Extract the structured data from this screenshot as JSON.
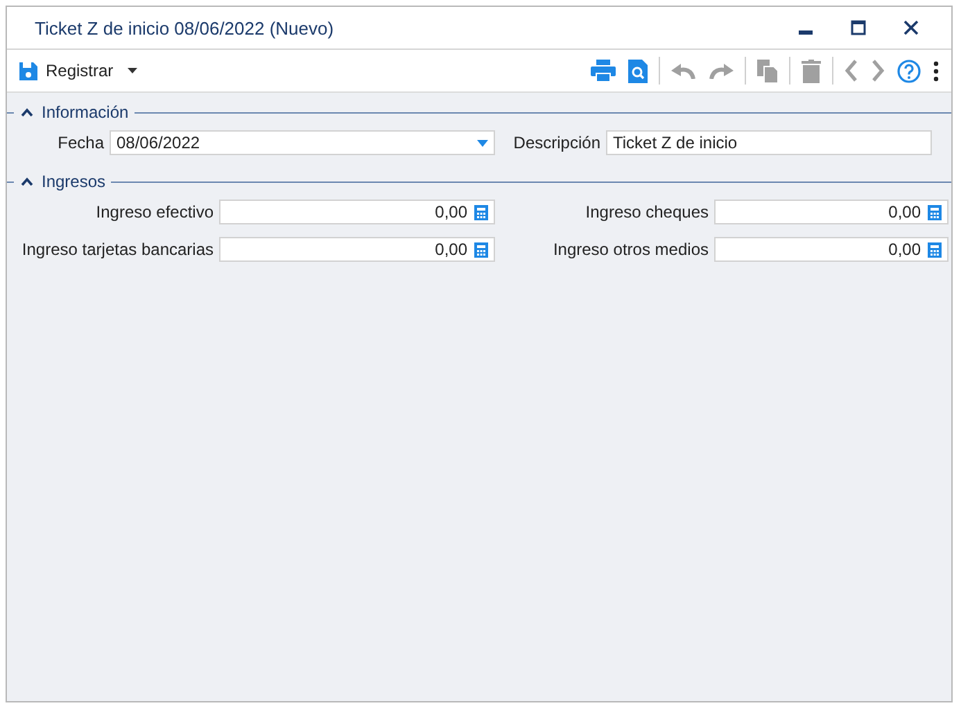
{
  "window": {
    "title": "Ticket Z de inicio 08/06/2022 (Nuevo)"
  },
  "toolbar": {
    "register_label": "Registrar",
    "tools": [
      {
        "kind": "print",
        "disabled": false
      },
      {
        "kind": "preview",
        "disabled": false
      },
      {
        "kind": "sep"
      },
      {
        "kind": "undo",
        "disabled": true
      },
      {
        "kind": "redo",
        "disabled": true
      },
      {
        "kind": "sep"
      },
      {
        "kind": "copy",
        "disabled": true
      },
      {
        "kind": "sep"
      },
      {
        "kind": "delete",
        "disabled": true
      },
      {
        "kind": "sep"
      },
      {
        "kind": "prev",
        "disabled": true
      },
      {
        "kind": "next",
        "disabled": true
      },
      {
        "kind": "help",
        "disabled": false
      },
      {
        "kind": "more",
        "disabled": false
      }
    ]
  },
  "sections": [
    {
      "title": "Información",
      "expanded": true,
      "fields": [
        {
          "kind": "date",
          "label": "Fecha",
          "value": "08/06/2022"
        },
        {
          "kind": "text",
          "label": "Descripción",
          "value": "Ticket Z de inicio"
        }
      ]
    },
    {
      "title": "Ingresos",
      "expanded": true,
      "fields": [
        {
          "kind": "number",
          "label": "Ingreso efectivo",
          "value": "0,00"
        },
        {
          "kind": "number",
          "label": "Ingreso cheques",
          "value": "0,00"
        },
        {
          "kind": "number",
          "label": "Ingreso tarjetas bancarias",
          "value": "0,00"
        },
        {
          "kind": "number",
          "label": "Ingreso otros medios",
          "value": "0,00"
        }
      ]
    }
  ]
}
